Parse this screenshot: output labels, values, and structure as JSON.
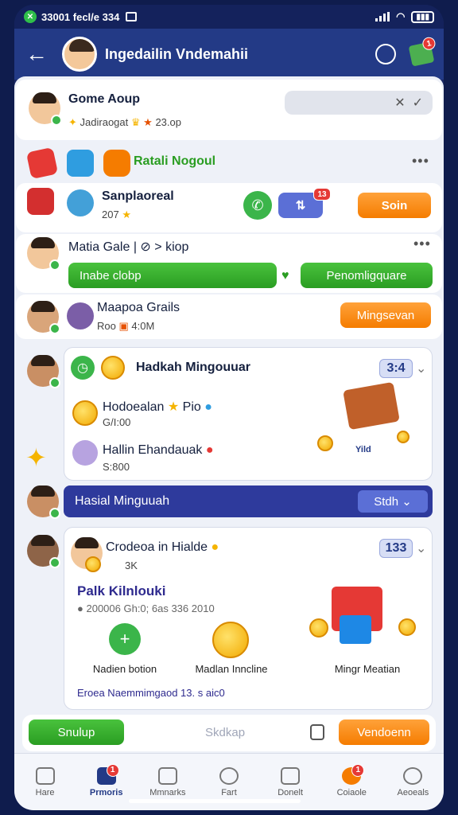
{
  "status": {
    "time": "33001 fecl/e 334"
  },
  "header": {
    "title": "Ingedailin Vndemahii",
    "gift_badge": "1"
  },
  "group": {
    "name": "Gome Aoup",
    "line1": "Jadiraogat",
    "line2": "23.op"
  },
  "promo": {
    "label": "Ratali Nogoul"
  },
  "item1": {
    "name": "Sanplaoreal",
    "sub": "207",
    "badge": "13",
    "btn": "Soin"
  },
  "item2": {
    "name": "Matia Gale",
    "tag": "> kiop",
    "btn_left": "Inabe clobp",
    "btn_right": "Penomligquare"
  },
  "item3": {
    "name": "Maapoa Grails",
    "sub_a": "Roo",
    "sub_b": "4:0M",
    "btn": "Mingsevan"
  },
  "card1": {
    "title": "Hadkah Mingouuar",
    "pill": "3:4",
    "entry1_name": "Hodoealan",
    "entry1_extra": "Pio",
    "entry1_sub": "G/I:00",
    "entry2_name": "Hallin Ehandauak",
    "entry2_sub": "S:800",
    "prize_label": "Yild"
  },
  "banner": {
    "title": "Hasial Minguuah",
    "btn": "Stdh"
  },
  "card2": {
    "title": "Crodeoa in Hialde",
    "pill": "133",
    "sub": "3K",
    "heading": "Palk Kilnlouki",
    "meta": "200006 Gh:0; 6as 336 2010",
    "act1": "Nadien botion",
    "act2": "Madlan Inncline",
    "act3": "Mingr Meatian",
    "footer": "Eroea Naemmimgaod 13. s aic0"
  },
  "action_bar": {
    "left": "Snulup",
    "center": "Skdkap",
    "right": "Vendoenn"
  },
  "nav": [
    {
      "label": "Hare"
    },
    {
      "label": "Prmoris",
      "badge": "1"
    },
    {
      "label": "Mmnarks"
    },
    {
      "label": "Fart"
    },
    {
      "label": "Donelt"
    },
    {
      "label": "Coiaole",
      "badge": "1"
    },
    {
      "label": "Aeoeals"
    }
  ],
  "colors": {
    "primary": "#233a86",
    "accent": "#f57c00",
    "success": "#2a9d22"
  }
}
